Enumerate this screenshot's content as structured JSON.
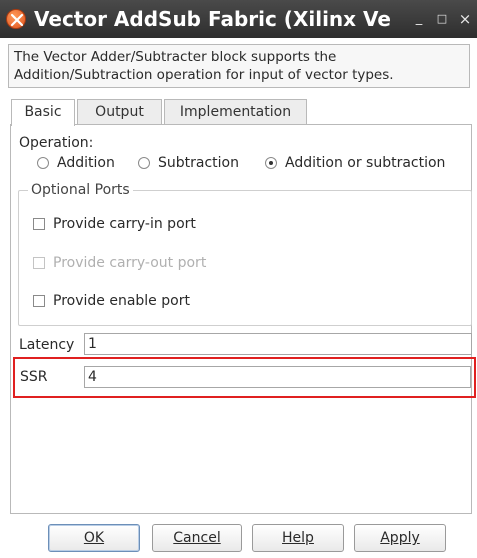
{
  "window": {
    "title": "Vector AddSub Fabric (Xilinx Ve",
    "minimize_glyph": "_",
    "maximize_glyph": "□",
    "close_glyph": "×"
  },
  "description": "The Vector Adder/Subtracter block supports the Addition/Subtraction operation for input of vector types.",
  "tabs": [
    {
      "label": "Basic",
      "active": true
    },
    {
      "label": "Output",
      "active": false
    },
    {
      "label": "Implementation",
      "active": false
    }
  ],
  "operation": {
    "label": "Operation:",
    "options": [
      {
        "label": "Addition",
        "selected": false
      },
      {
        "label": "Subtraction",
        "selected": false
      },
      {
        "label": "Addition or subtraction",
        "selected": true
      }
    ]
  },
  "optional_ports": {
    "title": "Optional Ports",
    "items": [
      {
        "label": "Provide carry-in port",
        "checked": false,
        "enabled": true
      },
      {
        "label": "Provide carry-out port",
        "checked": false,
        "enabled": false
      },
      {
        "label": "Provide enable port",
        "checked": false,
        "enabled": true
      }
    ]
  },
  "latency": {
    "label": "Latency",
    "value": "1"
  },
  "ssr": {
    "label": "SSR",
    "value": "4"
  },
  "buttons": {
    "ok": "OK",
    "cancel": "Cancel",
    "help": "Help",
    "apply": "Apply"
  },
  "colors": {
    "highlight_border": "#e02020",
    "titlebar": "#3a3a3a"
  }
}
